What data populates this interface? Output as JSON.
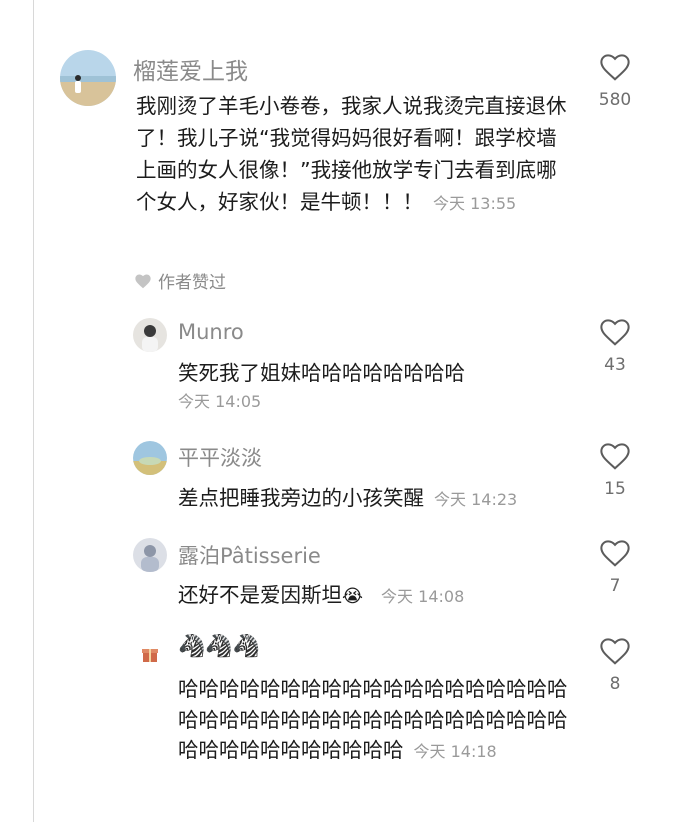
{
  "comments": [
    {
      "username": "榴莲爱上我",
      "text": "我刚烫了羊毛小卷卷，我家人说我烫完直接退休了！我儿子说“我觉得妈妈很好看啊！跟学校墙上画的女人很像！”我接他放学专门去看到底哪个女人，好家伙！是牛顿！！！",
      "time": "今天 13:55",
      "likes": "580",
      "author_liked": "作者赞过"
    },
    {
      "username": "Munro",
      "text": "笑死我了姐妹哈哈哈哈哈哈哈哈",
      "time": "今天 14:05",
      "likes": "43"
    },
    {
      "username": "平平淡淡",
      "text": "差点把睡我旁边的小孩笑醒",
      "time": "今天 14:23",
      "likes": "15"
    },
    {
      "username": "露泊Pâtisserie",
      "text": "还好不是爱因斯坦",
      "emoji": "😭",
      "time": "今天 14:08",
      "likes": "7"
    },
    {
      "username": "🦓🦓🦓",
      "text": "哈哈哈哈哈哈哈哈哈哈哈哈哈哈哈哈哈哈哈哈哈哈哈哈哈哈哈哈哈哈哈哈哈哈哈哈哈哈哈哈哈哈哈哈哈哈哈哈哈",
      "time": "今天 14:18",
      "likes": "8"
    }
  ],
  "icons": {
    "like": "heart-outline-icon",
    "author_like": "heart-filled-icon"
  }
}
